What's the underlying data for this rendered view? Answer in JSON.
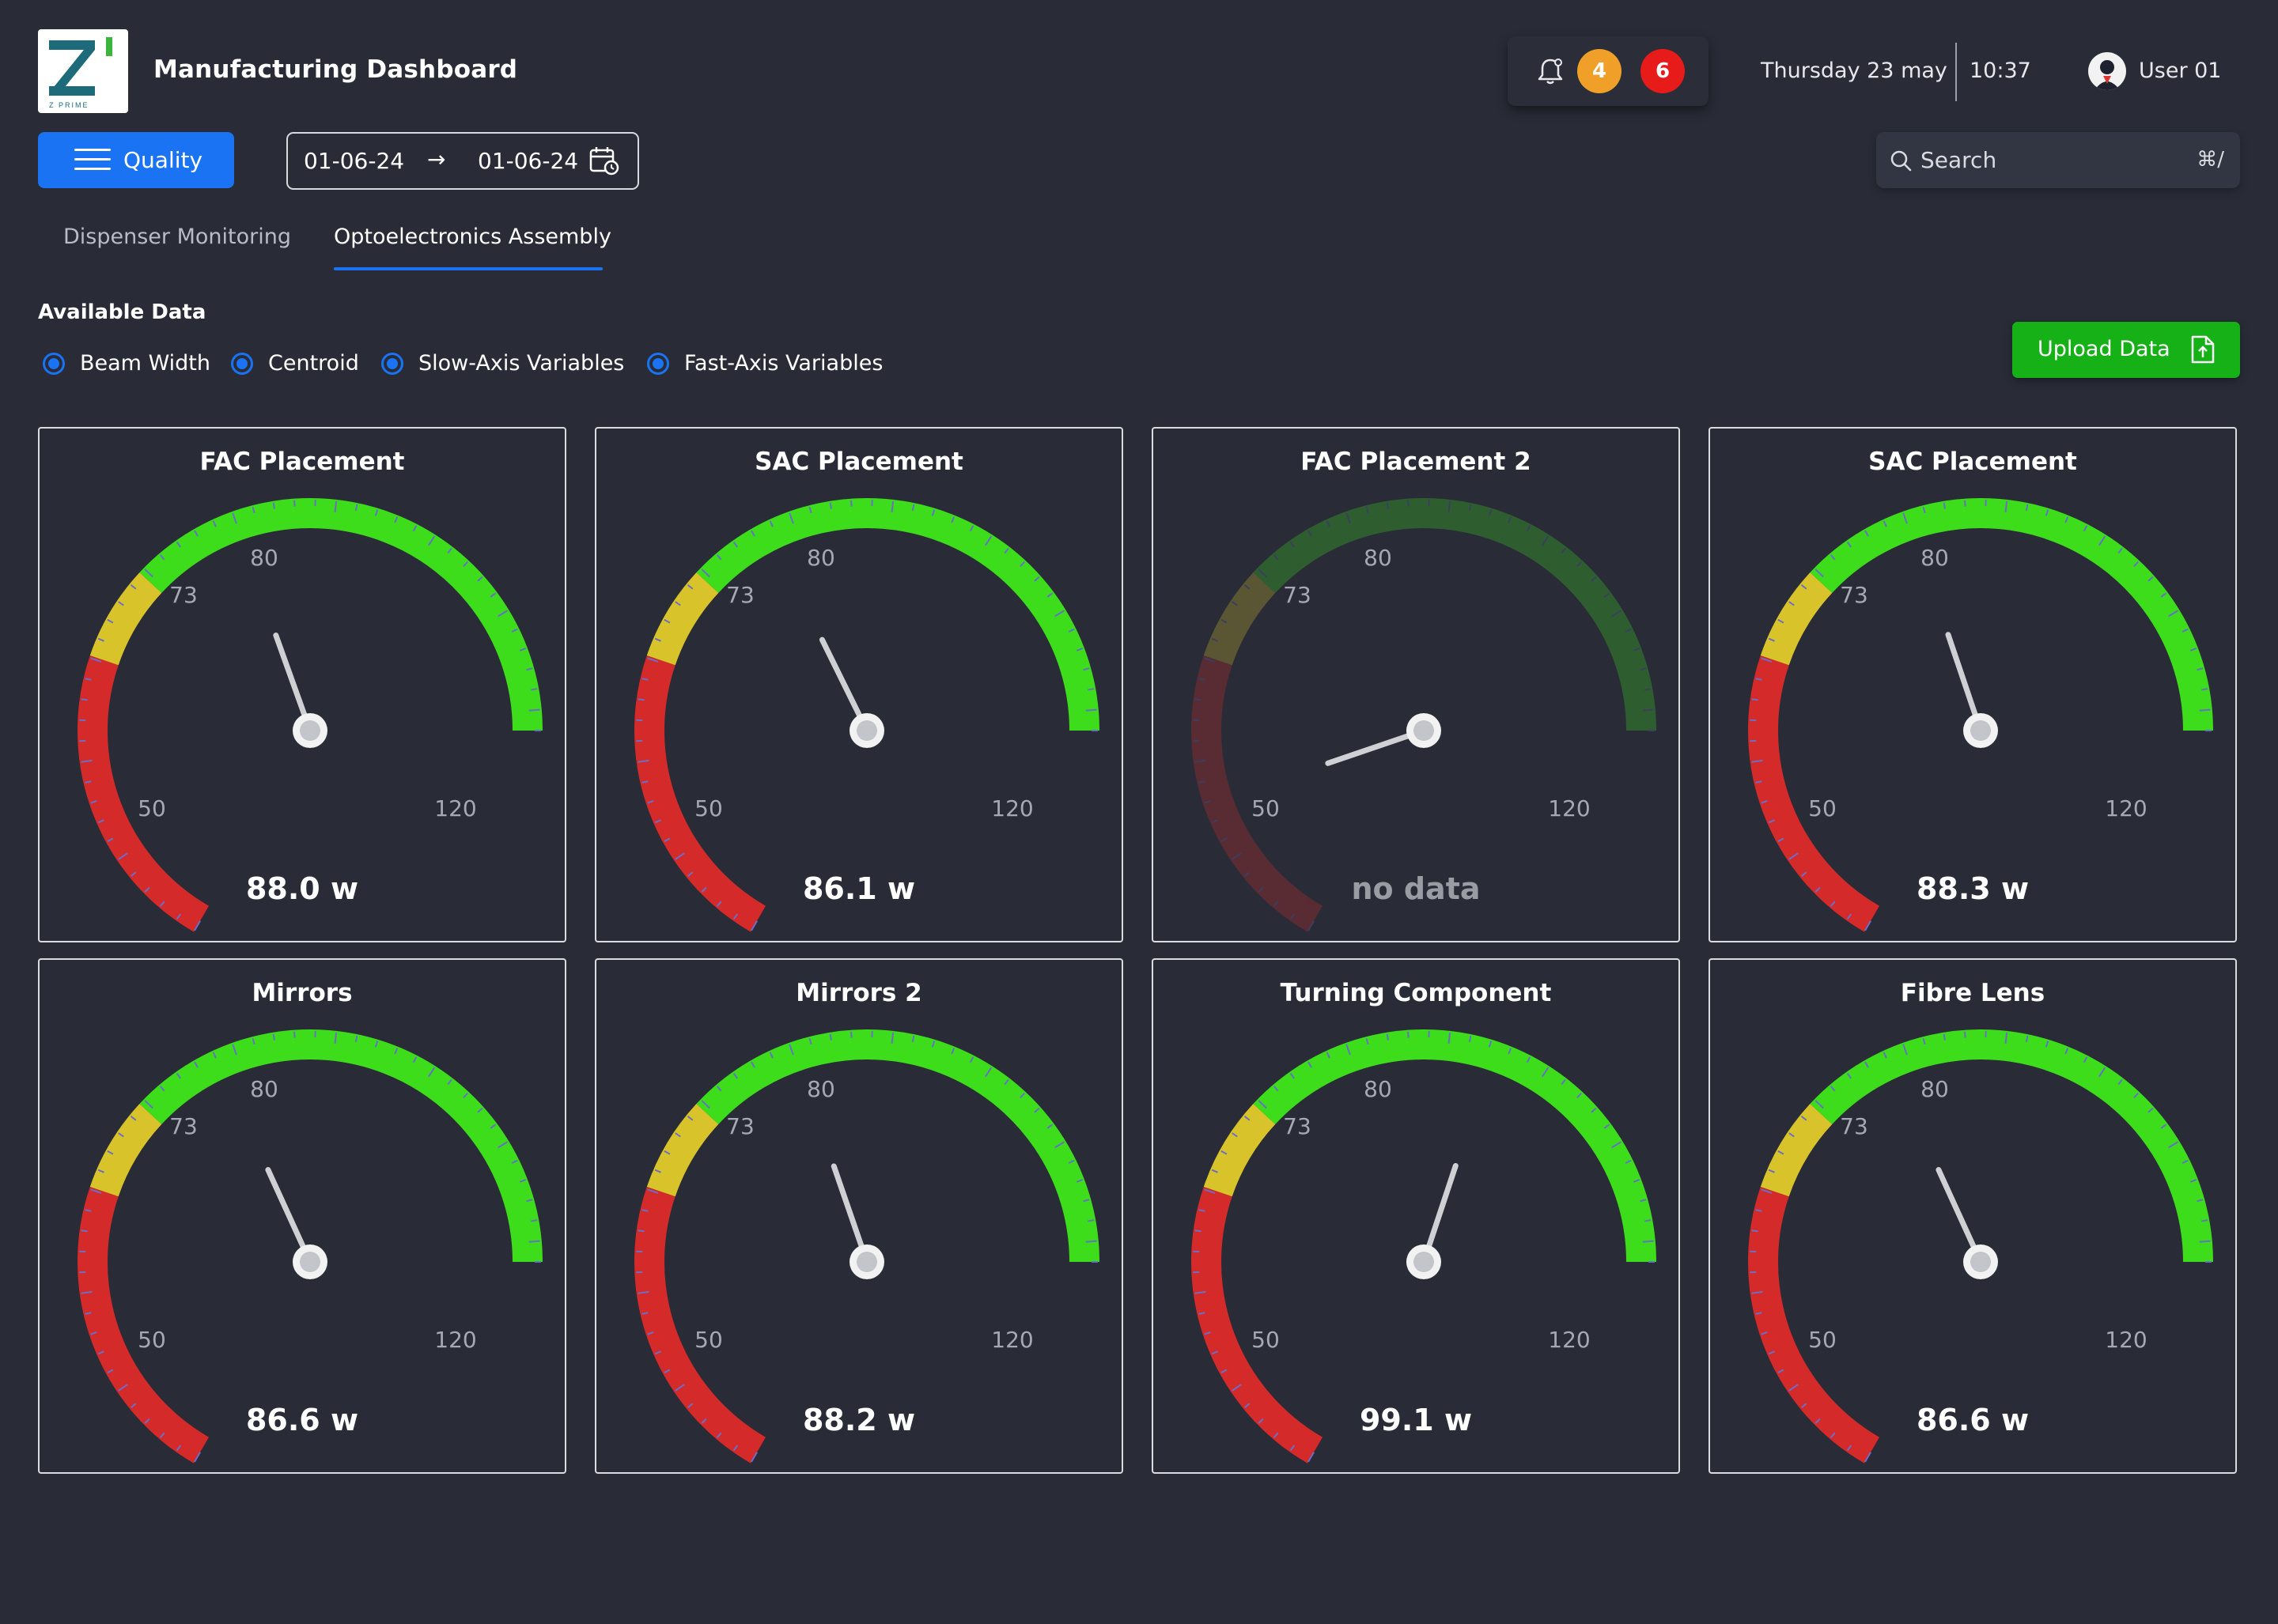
{
  "header": {
    "app_title": "Manufacturing Dashboard",
    "logo_text": "Z PRIME",
    "notifications": {
      "badge_warning_count": "4",
      "badge_warning_color": "#f0a028",
      "badge_alert_count": "6",
      "badge_alert_color": "#e81b1b"
    },
    "date": "Thursday 23 may",
    "time": "10:37",
    "user_name": "User 01"
  },
  "toolbar": {
    "quality_label": "Quality",
    "date_from": "01-06-24",
    "date_arrow": "→",
    "date_to": "01-06-24",
    "search_placeholder": "Search",
    "search_shortcut": "⌘/"
  },
  "tabs": [
    {
      "label": "Dispenser Monitoring",
      "active": false
    },
    {
      "label": "Optoelectronics Assembly",
      "active": true
    }
  ],
  "available_data": {
    "label": "Available Data",
    "options": [
      {
        "label": "Beam Width",
        "selected": true
      },
      {
        "label": "Centroid",
        "selected": true
      },
      {
        "label": "Slow-Axis Variables",
        "selected": true
      },
      {
        "label": "Fast-Axis Variables",
        "selected": true
      }
    ],
    "upload_label": "Upload Data"
  },
  "gauge_scale": {
    "min": 50,
    "max": 120,
    "tick_labels": [
      "50",
      "73",
      "80",
      "120"
    ],
    "zones": [
      {
        "from": 50,
        "to": 73,
        "color": "#d42a2a"
      },
      {
        "from": 73,
        "to": 80,
        "color": "#d8c42a"
      },
      {
        "from": 80,
        "to": 120,
        "color": "#3ddd1c"
      }
    ]
  },
  "gauges": [
    {
      "title": "FAC Placement",
      "value": 88.0,
      "display": "88.0 w",
      "has_data": true
    },
    {
      "title": "SAC Placement",
      "value": 86.1,
      "display": "86.1 w",
      "has_data": true
    },
    {
      "title": "FAC Placement 2",
      "value": 62,
      "display": "no data",
      "has_data": false
    },
    {
      "title": "SAC Placement",
      "value": 88.3,
      "display": "88.3 w",
      "has_data": true
    },
    {
      "title": "Mirrors",
      "value": 86.6,
      "display": "86.6 w",
      "has_data": true
    },
    {
      "title": "Mirrors 2",
      "value": 88.2,
      "display": "88.2 w",
      "has_data": true
    },
    {
      "title": "Turning Component",
      "value": 99.1,
      "display": "99.1 w",
      "has_data": true
    },
    {
      "title": "Fibre Lens",
      "value": 86.6,
      "display": "86.6 w",
      "has_data": true
    }
  ]
}
